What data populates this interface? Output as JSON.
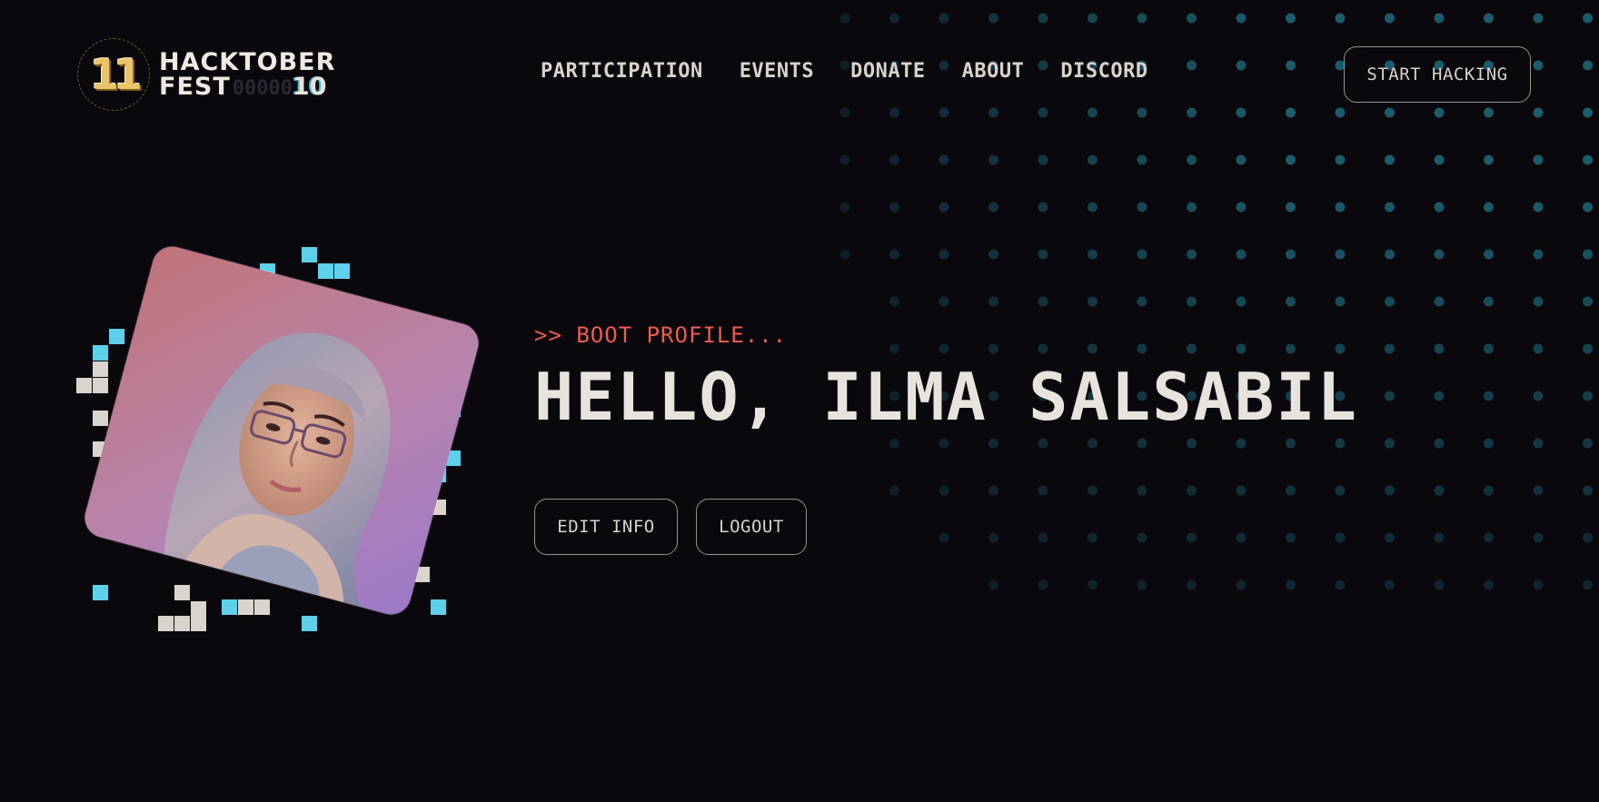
{
  "header": {
    "logo": {
      "badge_text": "11",
      "line1": "HACKTOBER",
      "line2": "FEST",
      "pixel_blocks": "00000",
      "edition": "10"
    },
    "nav": [
      {
        "label": "PARTICIPATION"
      },
      {
        "label": "EVENTS"
      },
      {
        "label": "DONATE"
      },
      {
        "label": "ABOUT"
      },
      {
        "label": "DISCORD"
      }
    ],
    "cta_label": "START HACKING"
  },
  "profile": {
    "boot_text": ">> BOOT PROFILE...",
    "greeting": "HELLO, ILMA SALSABIL",
    "edit_label": "EDIT INFO",
    "logout_label": "LOGOUT",
    "avatar_alt_icon": "user-photo"
  },
  "colors": {
    "background": "#0a070d",
    "accent_red": "#ef5b4c",
    "text": "#e8e3dd",
    "dot_teal": "#1a5c6b",
    "pixel_blue": "#5fd0ea",
    "pixel_bone": "#d9d5cc"
  }
}
